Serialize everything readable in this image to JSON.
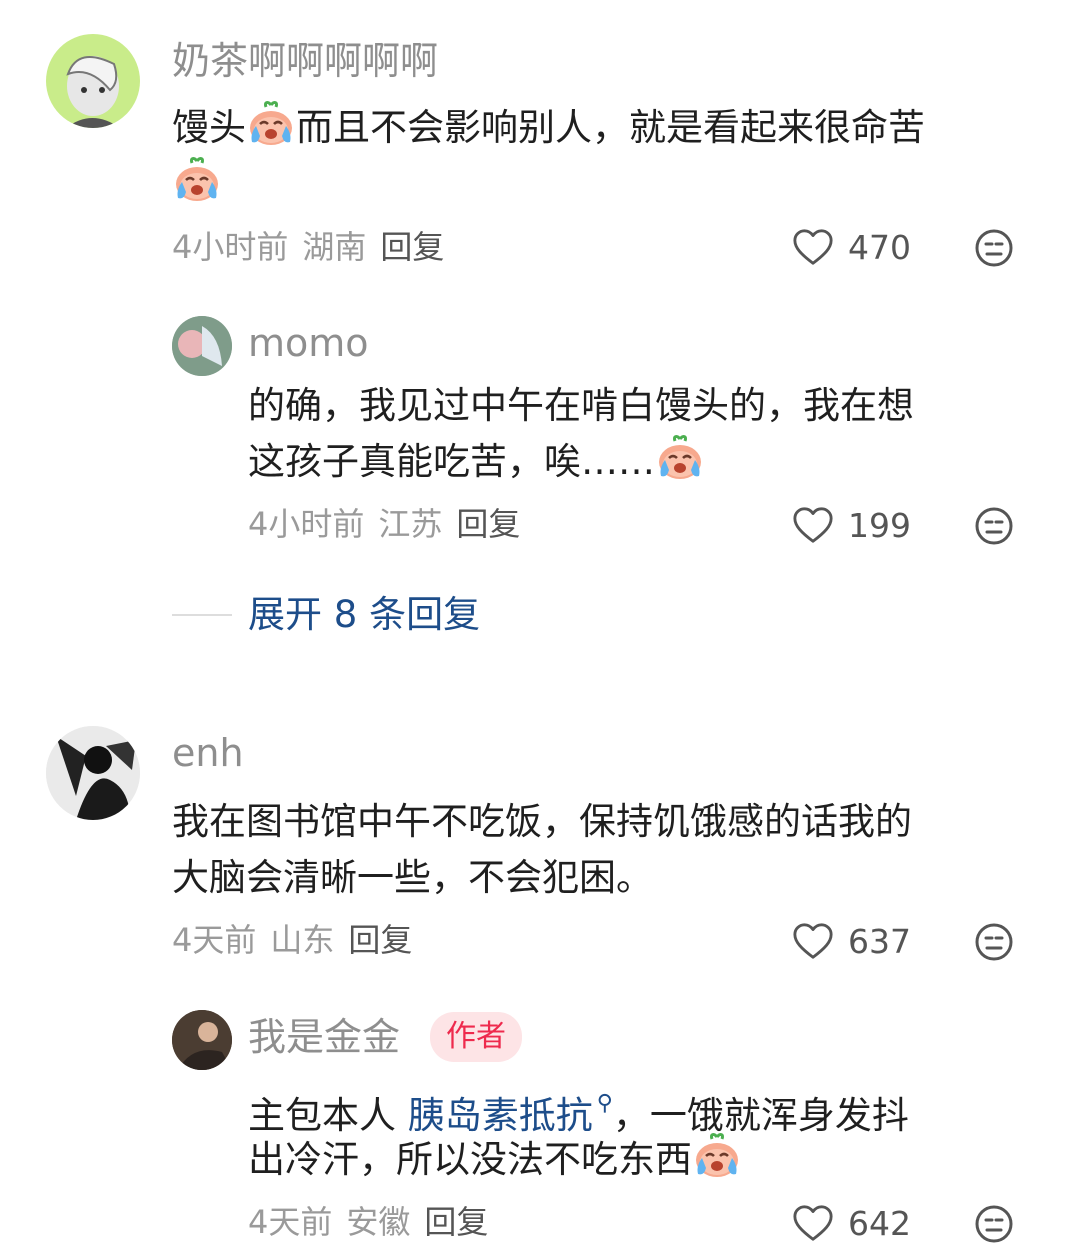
{
  "comments": [
    {
      "username": "奶茶啊啊啊啊啊",
      "line1": "馒头",
      "line1b": "而且不会影响别人，就是看起来很命苦",
      "time": "4小时前",
      "location": "湖南",
      "reply_label": "回复",
      "likes": "470"
    },
    {
      "username": "momo",
      "line1": "的确，我见过中午在啃白馒头的，我在想",
      "line2": "这孩子真能吃苦，唉……",
      "time": "4小时前",
      "location": "江苏",
      "reply_label": "回复",
      "likes": "199"
    },
    {
      "username": "enh",
      "line1": "我在图书馆中午不吃饭，保持饥饿感的话我的",
      "line2": "大脑会清晰一些，不会犯困。",
      "time": "4天前",
      "location": "山东",
      "reply_label": "回复",
      "likes": "637"
    },
    {
      "username": "我是金金",
      "badge": "作者",
      "line1_prefix": "主包本人 ",
      "line1_link": "胰岛素抵抗",
      "line1_suffix": "，一饿就浑身发抖",
      "line2": "出冷汗，所以没法不吃东西",
      "time": "4天前",
      "location": "安徽",
      "reply_label": "回复",
      "likes": "642"
    }
  ],
  "expand_replies": "展开 8 条回复",
  "colors": {
    "link": "#1d4d8a",
    "badge_bg": "#fde4e6",
    "badge_text": "#ee2a4d"
  }
}
